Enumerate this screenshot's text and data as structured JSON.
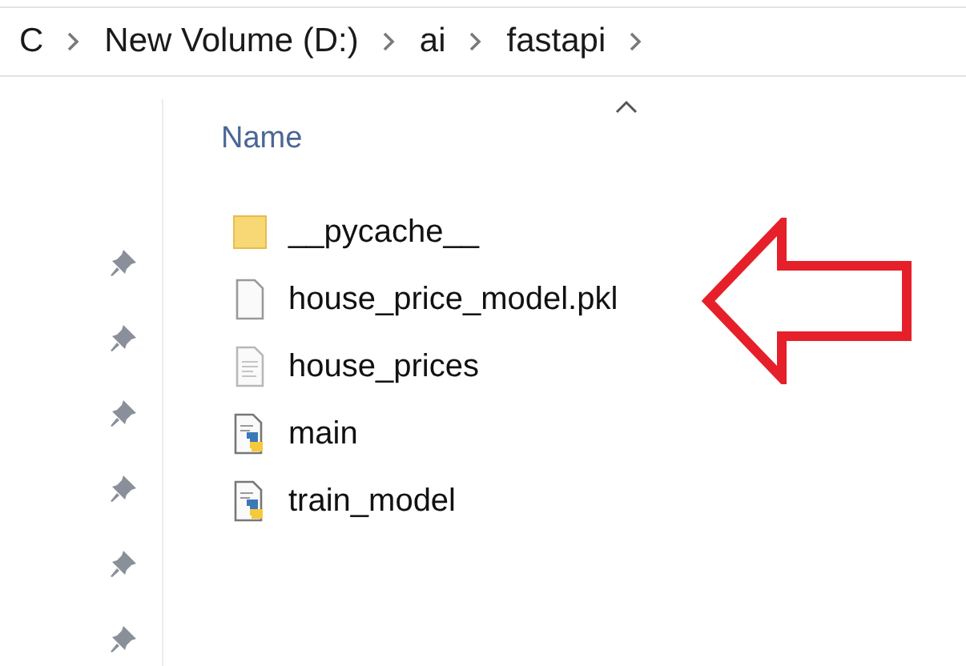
{
  "breadcrumb": [
    "C",
    "New Volume (D:)",
    "ai",
    "fastapi"
  ],
  "column_header": {
    "label": "Name",
    "sorted": true
  },
  "files": [
    {
      "name": "__pycache__",
      "kind": "folder"
    },
    {
      "name": "house_price_model.pkl",
      "kind": "file"
    },
    {
      "name": "house_prices",
      "kind": "text"
    },
    {
      "name": "main",
      "kind": "python"
    },
    {
      "name": "train_model",
      "kind": "python"
    }
  ]
}
